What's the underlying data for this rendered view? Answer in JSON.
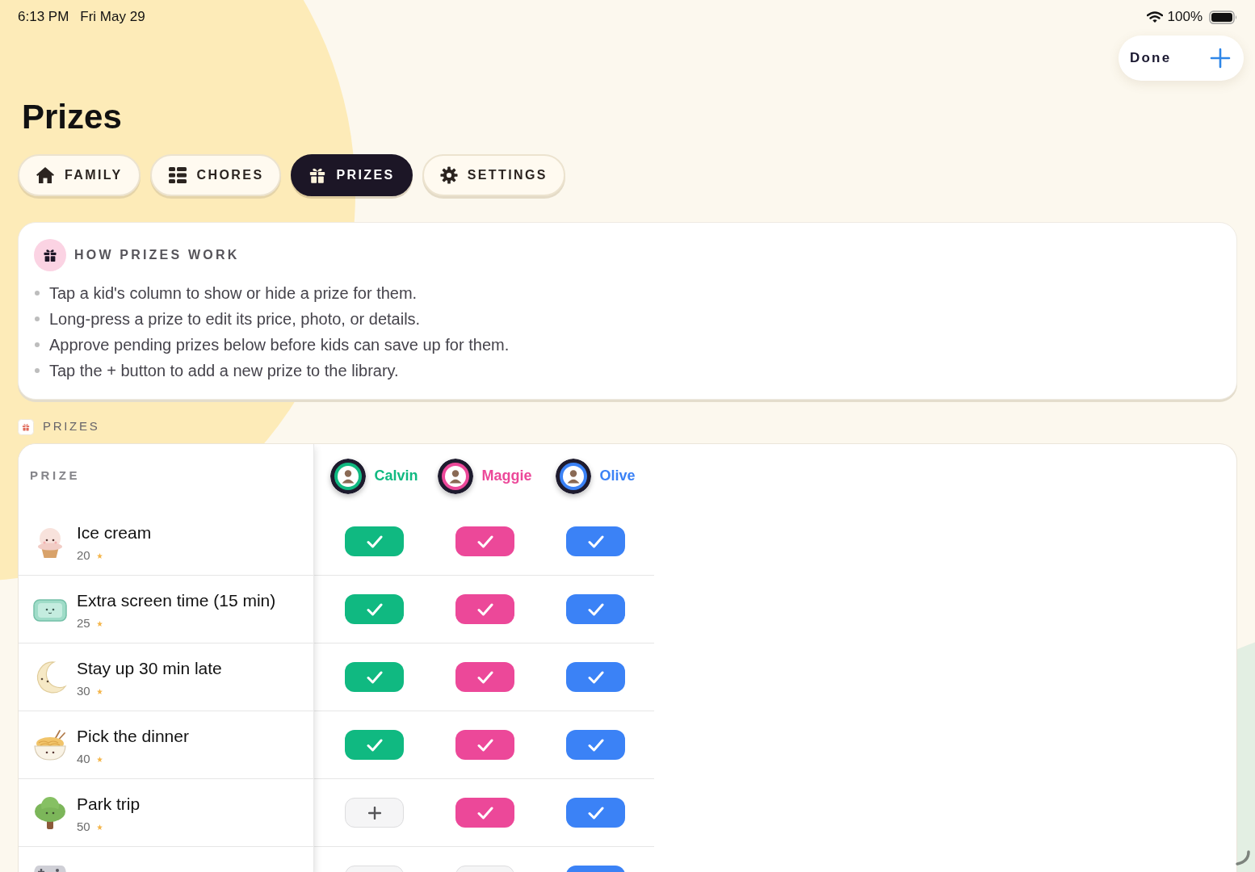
{
  "status_bar": {
    "time": "6:13 PM",
    "date": "Fri May 29",
    "battery": "100%"
  },
  "toolbar": {
    "done": "Done"
  },
  "title": "Prizes",
  "tabs": [
    {
      "label": "FAMILY",
      "kind": "family",
      "selected": false
    },
    {
      "label": "CHORES",
      "kind": "chores",
      "selected": false
    },
    {
      "label": "PRIZES",
      "kind": "prizes",
      "selected": true
    },
    {
      "label": "SETTINGS",
      "kind": "settings",
      "selected": false
    }
  ],
  "info_card": {
    "title": "HOW PRIZES WORK",
    "bullets": [
      "Tap a kid's column to show or hide a prize for them.",
      "Long-press a prize to edit its price, photo, or details.",
      "Approve pending prizes below before kids can save up for them.",
      "Tap the + button to add a new prize to the library."
    ]
  },
  "section": {
    "label": "PRIZES"
  },
  "table": {
    "prize_header": "PRIZE",
    "kids": [
      {
        "name": "Calvin",
        "color": "#10b981"
      },
      {
        "name": "Maggie",
        "color": "#ec4899"
      },
      {
        "name": "Olive",
        "color": "#3b82f6"
      }
    ],
    "rows": [
      {
        "kind": "icecream",
        "name": "Ice cream",
        "price": "20",
        "cells": [
          {
            "checked": true
          },
          {
            "checked": true
          },
          {
            "checked": true
          }
        ]
      },
      {
        "kind": "screen",
        "name": "Extra screen time (15 min)",
        "price": "25",
        "cells": [
          {
            "checked": true
          },
          {
            "checked": true
          },
          {
            "checked": true
          }
        ]
      },
      {
        "kind": "moon",
        "name": "Stay up 30 min late",
        "price": "30",
        "cells": [
          {
            "checked": true
          },
          {
            "checked": true
          },
          {
            "checked": true
          }
        ]
      },
      {
        "kind": "noodles",
        "name": "Pick the dinner",
        "price": "40",
        "cells": [
          {
            "checked": true
          },
          {
            "checked": true
          },
          {
            "checked": true
          }
        ]
      },
      {
        "kind": "tree",
        "name": "Park trip",
        "price": "50",
        "cells": [
          {
            "checked": false
          },
          {
            "checked": true
          },
          {
            "checked": true
          }
        ]
      },
      {
        "kind": "game",
        "cells": [
          {
            "checked": false
          },
          {
            "checked": false
          },
          {
            "checked": true
          }
        ]
      }
    ]
  }
}
